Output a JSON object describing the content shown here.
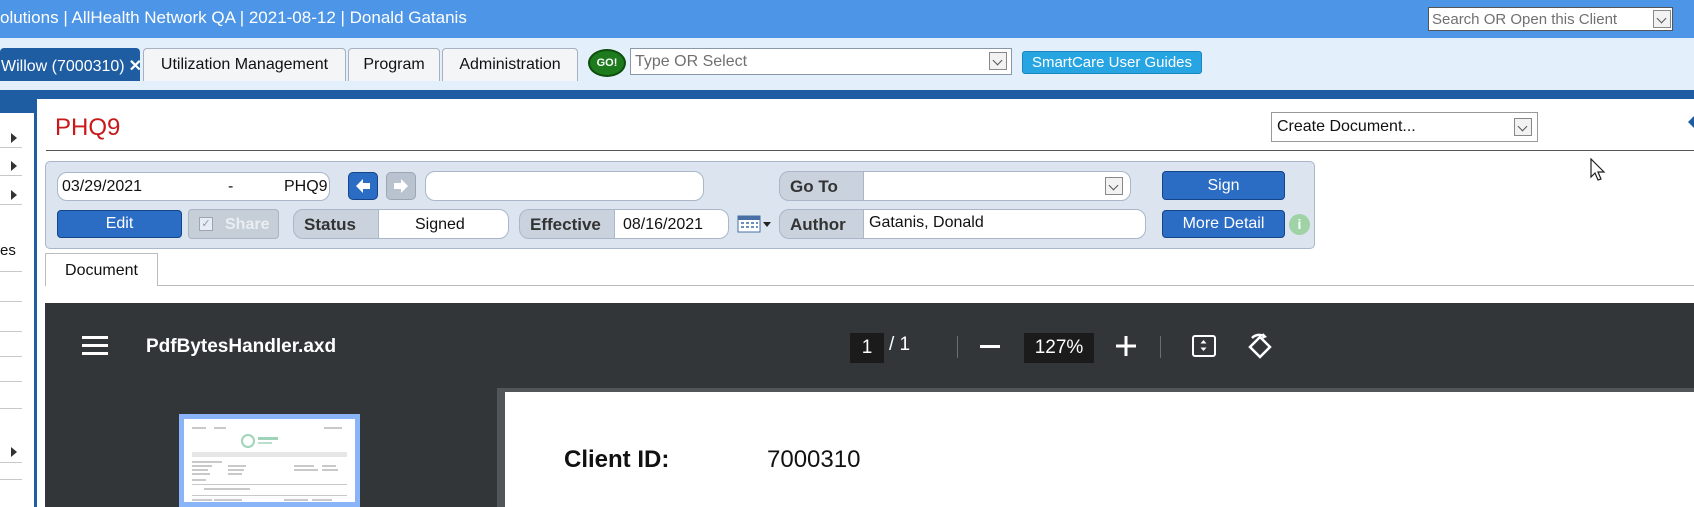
{
  "header": {
    "title": "olutions | AllHealth Network QA | 2021-08-12 | Donald Gatanis",
    "client_search_placeholder": "Search OR Open this Client"
  },
  "tabs": [
    {
      "label": "Willow (7000310)",
      "close": "✕"
    },
    {
      "label": "Utilization Management"
    },
    {
      "label": "Program"
    },
    {
      "label": "Administration"
    }
  ],
  "quick_nav": {
    "go_label": "GO!",
    "type_select_placeholder": "Type OR Select",
    "guides_label": "SmartCare User Guides"
  },
  "sidebar": {
    "partial_text": "es"
  },
  "document": {
    "title": "PHQ9",
    "create_document": "Create Document...",
    "date": "03/29/2021",
    "dash": "-",
    "doc_name": "PHQ9",
    "edit_label": "Edit",
    "share_label": "Share",
    "status_label": "Status",
    "status_value": "Signed",
    "effective_label": "Effective",
    "effective_value": "08/16/2021",
    "goto_label": "Go To",
    "author_label": "Author",
    "author_value": "Gatanis, Donald",
    "sign_label": "Sign",
    "more_detail_label": "More Detail",
    "info_icon": "i",
    "tab_label": "Document"
  },
  "pdf_viewer": {
    "file_name": "PdfBytesHandler.axd",
    "current_page": "1",
    "page_total": "/ 1",
    "zoom": "127%",
    "client_id_label": "Client ID:",
    "client_id_value": "7000310"
  },
  "colors": {
    "header_blue": "#4d95e6",
    "tab_active": "#1f5da3",
    "title_red": "#c81a1a",
    "pdf_toolbar": "#323639"
  }
}
